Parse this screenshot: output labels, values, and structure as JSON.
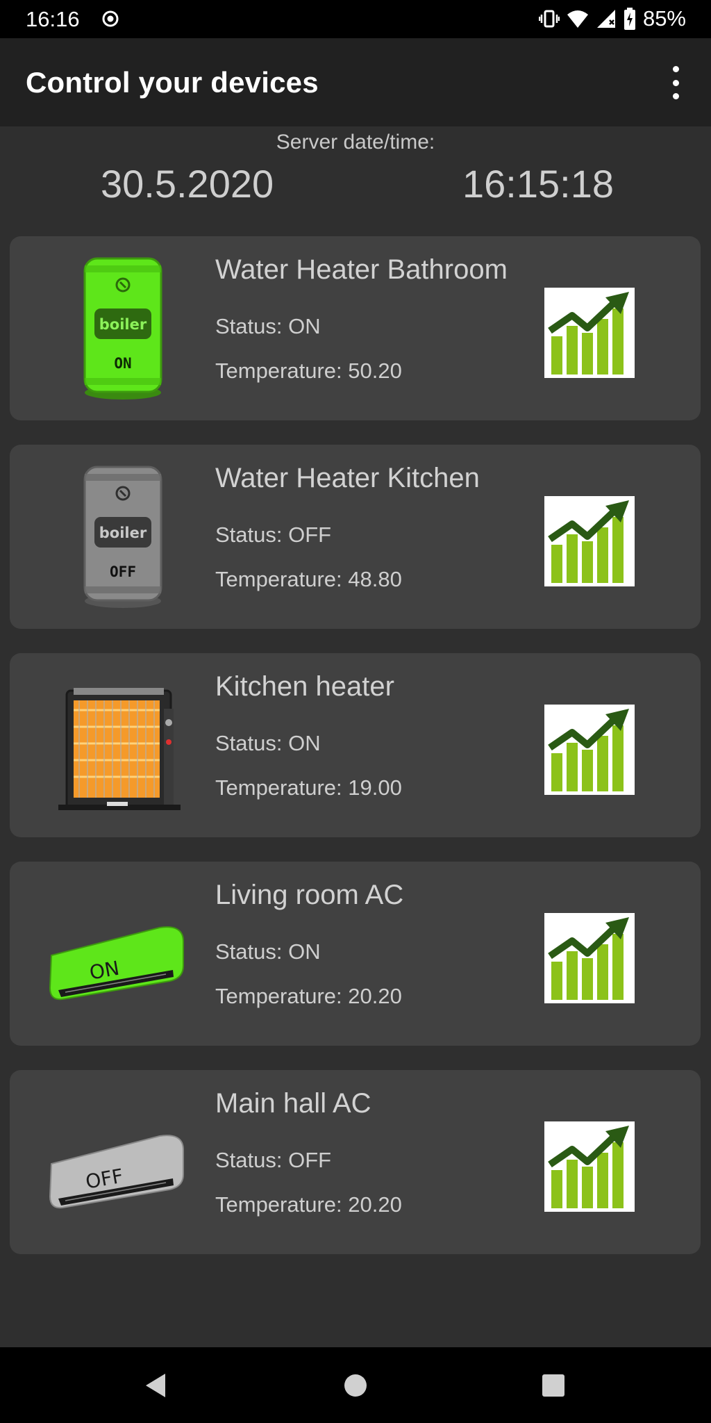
{
  "status_bar": {
    "time": "16:16",
    "battery": "85%",
    "icons": [
      "record-icon",
      "vibrate-icon",
      "wifi-icon",
      "signal-icon",
      "battery-charging-icon"
    ]
  },
  "app_bar": {
    "title": "Control your devices",
    "menu_icon": "more-vert-icon"
  },
  "server": {
    "label": "Server date/time:",
    "date": "30.5.2020",
    "time": "16:15:18"
  },
  "devices": [
    {
      "name": "Water Heater Bathroom",
      "status": "Status: ON",
      "temperature": "Temperature: 50.20",
      "image": "boiler-on-icon",
      "badge": "ON",
      "boiler_label": "boiler"
    },
    {
      "name": "Water Heater Kitchen",
      "status": "Status: OFF",
      "temperature": "Temperature: 48.80",
      "image": "boiler-off-icon",
      "badge": "OFF",
      "boiler_label": "boiler"
    },
    {
      "name": "Kitchen heater",
      "status": "Status: ON",
      "temperature": "Temperature: 19.00",
      "image": "heater-icon"
    },
    {
      "name": "Living room AC",
      "status": "Status: ON",
      "temperature": "Temperature: 20.20",
      "image": "ac-on-icon",
      "badge": "ON"
    },
    {
      "name": "Main hall AC",
      "status": "Status: OFF",
      "temperature": "Temperature: 20.20",
      "image": "ac-off-icon",
      "badge": "OFF"
    }
  ],
  "colors": {
    "on_green": "#5ee61a",
    "off_gray": "#8a8a8a",
    "chart_green": "#8cc21a",
    "chart_dark": "#2a5a14"
  },
  "nav_bar": {
    "icons": [
      "back-icon",
      "home-icon",
      "recents-icon"
    ]
  }
}
